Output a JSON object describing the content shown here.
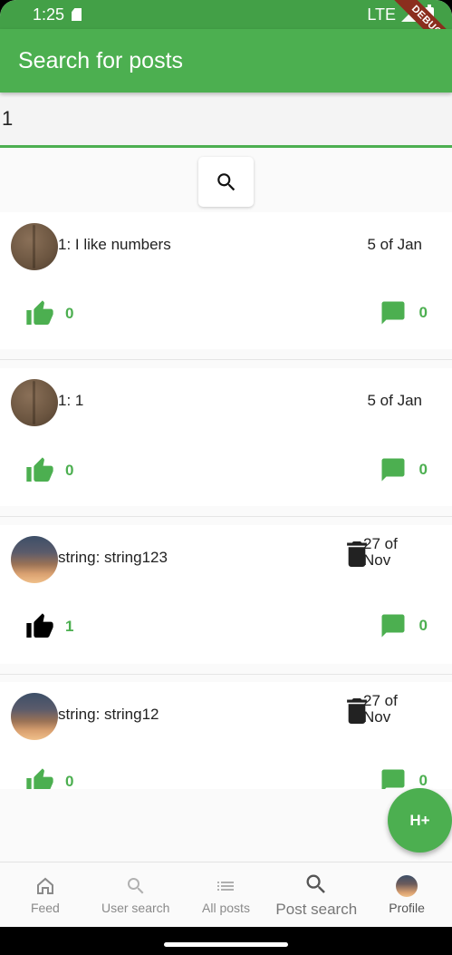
{
  "status_bar": {
    "time": "1:25",
    "network": "LTE"
  },
  "debug_banner": "DEBUG",
  "app_bar": {
    "title": "Search for posts"
  },
  "search": {
    "value": "1"
  },
  "posts": [
    {
      "title": "1: I like numbers",
      "date": "5 of Jan",
      "likes": "0",
      "comments": "0",
      "deletable": false
    },
    {
      "title": "1: 1",
      "date": "5 of Jan",
      "likes": "0",
      "comments": "0",
      "deletable": false
    },
    {
      "title": "string: string123",
      "date": "27 of Nov",
      "likes": "1",
      "comments": "0",
      "deletable": true
    },
    {
      "title": "string: string12",
      "date": "27 of Nov",
      "likes": "0",
      "comments": "0",
      "deletable": true
    }
  ],
  "fab": {
    "label": "H+"
  },
  "bottom_nav": {
    "items": [
      {
        "label": "Feed",
        "icon": "home-icon"
      },
      {
        "label": "User search",
        "icon": "search-icon"
      },
      {
        "label": "All posts",
        "icon": "list-icon"
      },
      {
        "label": "Post search",
        "icon": "search-icon",
        "active": true
      },
      {
        "label": "Profile",
        "icon": "avatar"
      }
    ]
  },
  "colors": {
    "primary": "#4caf50",
    "status_bar": "#43a047",
    "debug_ribbon": "#8b2e1e"
  }
}
